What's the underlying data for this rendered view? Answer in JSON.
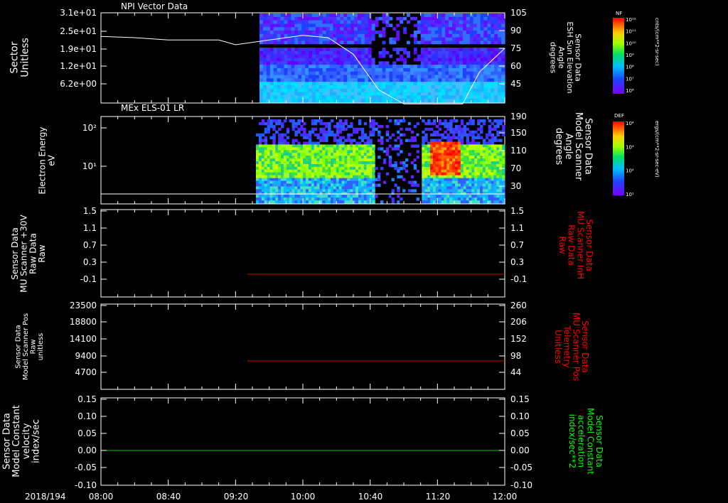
{
  "date_label": "2018/194",
  "x_ticks": [
    "08:00",
    "08:40",
    "09:20",
    "10:00",
    "10:40",
    "11:20",
    "12:00"
  ],
  "panels": [
    {
      "title": "NPI Vector Data",
      "left_label": [
        "Sector",
        "Unitless"
      ],
      "left_ticks": [
        "3.1e+01",
        "2.5e+01",
        "1.9e+01",
        "1.2e+01",
        "6.2e+00"
      ],
      "right_label": [
        "Sensor Data",
        "ESH Sun Elevation",
        "Angle",
        "degrees"
      ],
      "right_ticks": [
        "105",
        "90",
        "75",
        "60",
        "45"
      ],
      "colorbar": {
        "name": "NF",
        "unit": "cnts/(cm**2-sr-sec)",
        "ticks": [
          "10¹²",
          "10¹¹",
          "10¹⁰",
          "10⁹",
          "10⁸",
          "10⁷",
          "10⁶"
        ]
      }
    },
    {
      "title": "MEx ELS-01 LR",
      "left_label": [
        "Electron Energy",
        "eV"
      ],
      "left_ticks": [
        "10²",
        "10¹"
      ],
      "right_label": [
        "Sensor Data",
        "Model Scanner",
        "Angle",
        "degrees"
      ],
      "right_ticks": [
        "190",
        "150",
        "110",
        "70",
        "30"
      ],
      "colorbar": {
        "name": "DEF",
        "unit": "ergs/(cm**2-sr-sec-eV)",
        "ticks": [
          "10⁴",
          "10³",
          "10²",
          "10¹"
        ]
      }
    },
    {
      "title": "",
      "left_label": [
        "Sensor Data",
        "MU Scanner +30V",
        "Raw Data",
        "Raw"
      ],
      "left_ticks": [
        "1.5",
        "1.1",
        "0.7",
        "0.3",
        "-0.1"
      ],
      "right_label": [
        "Sensor Data",
        "MU Scanner InH",
        "Raw Data",
        "Raw"
      ],
      "right_ticks": [
        "1.5",
        "1.1",
        "0.7",
        "0.3",
        "-0.1"
      ]
    },
    {
      "title": "",
      "left_label": [
        "Sensor Data",
        "Model Scanner Pos",
        "Raw",
        "unitless"
      ],
      "left_ticks": [
        "23500",
        "18800",
        "14100",
        "9400",
        "4700"
      ],
      "right_label": [
        "Sensor Data",
        "MU Scanner Pos",
        "Telemetry",
        "Unitless"
      ],
      "right_ticks": [
        "260",
        "206",
        "152",
        "98",
        "44"
      ]
    },
    {
      "title": "",
      "left_label": [
        "Sensor Data",
        "Model Constant",
        "velocity",
        "index/sec"
      ],
      "left_ticks": [
        "0.15",
        "0.10",
        "0.05",
        "0.00",
        "-0.05",
        "-0.10"
      ],
      "right_label": [
        "Sensor Data",
        "Model Constant",
        "acceleration",
        "index/sec**2"
      ],
      "right_ticks": [
        "0.15",
        "0.10",
        "0.05",
        "0.00",
        "-0.05",
        "-0.10"
      ]
    }
  ],
  "colors": {
    "red_line": "#d00000",
    "green_line": "#00d000",
    "white": "#ffffff",
    "right_red_label": "#ff0000",
    "right_green_label": "#00ff00"
  },
  "chart_data": [
    {
      "type": "heatmap",
      "title": "NPI Vector Data",
      "series": [
        {
          "name": "Sensor Data ESH Sun Elevation Angle",
          "x": [
            "08:00",
            "08:20",
            "08:40",
            "09:00",
            "09:10",
            "09:20",
            "09:40",
            "10:00",
            "10:15",
            "10:30",
            "10:45",
            "11:00",
            "11:15",
            "11:25",
            "11:35",
            "11:45",
            "12:00"
          ],
          "values": [
            85,
            84,
            82,
            82,
            82,
            78,
            82,
            86,
            84,
            70,
            40,
            28,
            28,
            28,
            28,
            55,
            75
          ]
        }
      ],
      "yrange_right": [
        30,
        105
      ]
    },
    {
      "type": "heatmap",
      "title": "MEx ELS-01 LR",
      "series": [
        {
          "name": "Sensor Data Model Scanner Angle",
          "x": [
            "08:00",
            "12:00"
          ],
          "values": [
            17,
            17
          ]
        }
      ],
      "yrange_right": [
        0,
        190
      ]
    },
    {
      "type": "line",
      "series": [
        {
          "name": "Sensor Data MU Scanner Inh Raw Data",
          "x": [
            "09:18",
            "12:00"
          ],
          "values": [
            -0.05,
            -0.05
          ]
        }
      ],
      "ylim": [
        -0.3,
        1.5
      ]
    },
    {
      "type": "line",
      "series": [
        {
          "name": "Sensor Data MU Scanner Pos Telemetry",
          "x": [
            "09:18",
            "12:00"
          ],
          "values": [
            98,
            98
          ]
        }
      ],
      "ylim": [
        0,
        260
      ]
    },
    {
      "type": "line",
      "series": [
        {
          "name": "Sensor Data Model Constant acceleration",
          "x": [
            "08:00",
            "12:00"
          ],
          "values": [
            0,
            0
          ]
        }
      ],
      "ylim": [
        -0.1,
        0.15
      ]
    }
  ]
}
